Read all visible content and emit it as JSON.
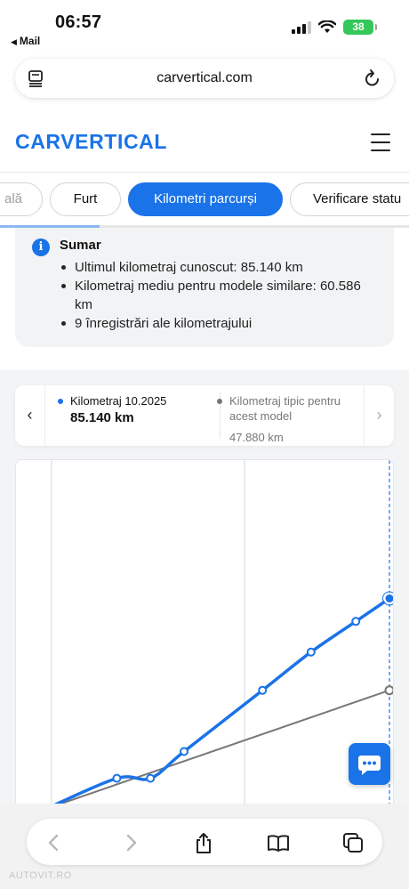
{
  "status": {
    "time": "06:57",
    "back_label": "Mail",
    "battery": "38"
  },
  "browser": {
    "url": "carvertical.com"
  },
  "site": {
    "logo": "CARVERTICAL"
  },
  "tabs": [
    {
      "label": "ală"
    },
    {
      "label": "Furt"
    },
    {
      "label": "Kilometri parcurși"
    },
    {
      "label": "Verificare statu"
    }
  ],
  "summary": {
    "title": "Sumar",
    "items": [
      "Ultimul kilometraj cunoscut: 85.140 km",
      "Kilometraj mediu pentru modele similare: 60.586 km",
      "9 înregistrări ale kilometrajului"
    ]
  },
  "legend": {
    "primary": {
      "label": "Kilometraj 10.2025",
      "value": "85.140 km",
      "color": "#1a73e8"
    },
    "secondary": {
      "label": "Kilometraj tipic pentru acest model",
      "value": "47.880 km",
      "color": "#777777"
    }
  },
  "chart_data": {
    "type": "line",
    "series": [
      {
        "name": "Kilometraj",
        "color": "#1a73e8",
        "points": [
          [
            0.08,
            0.0
          ],
          [
            0.27,
            0.08
          ],
          [
            0.36,
            0.08
          ],
          [
            0.45,
            0.15
          ],
          [
            0.66,
            0.31
          ],
          [
            0.79,
            0.41
          ],
          [
            0.91,
            0.49
          ],
          [
            1.0,
            0.55
          ]
        ]
      },
      {
        "name": "Kilometraj tipic pentru acest model",
        "color": "#777777",
        "points": [
          [
            0.08,
            0.0
          ],
          [
            1.0,
            0.31
          ]
        ]
      }
    ],
    "grid": true
  },
  "watermark": "AUTOVIT.RO"
}
